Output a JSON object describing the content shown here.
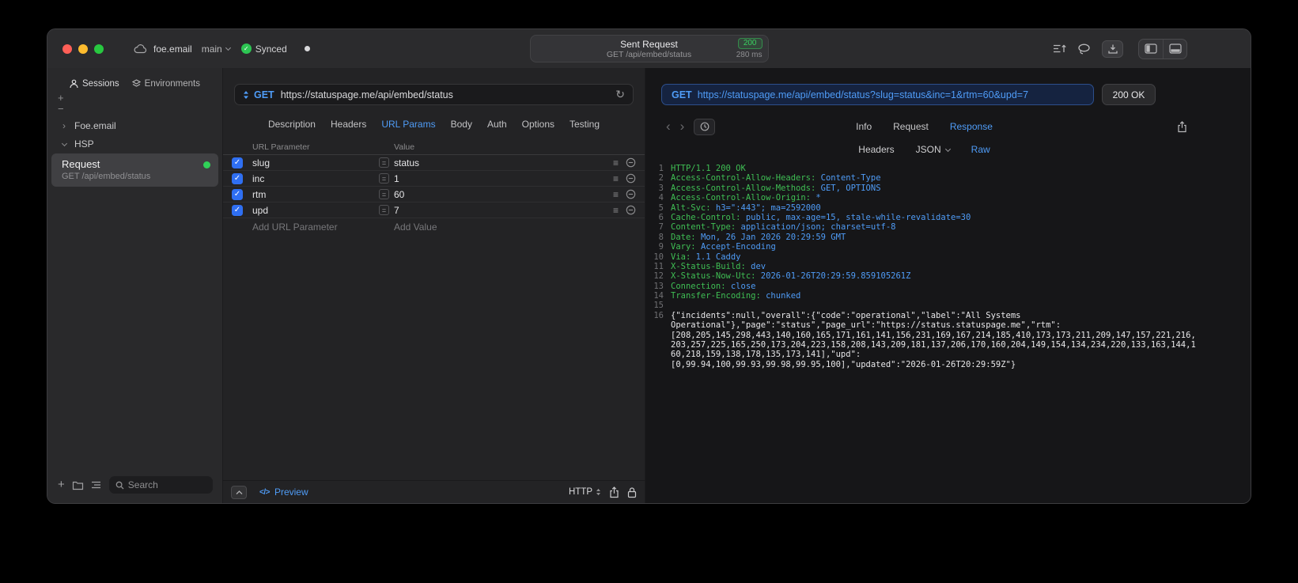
{
  "colors": {
    "accent_blue": "#4f9cf7",
    "header_green": "#3fbf54",
    "value_blue": "#4f9cf7",
    "status_green": "#30d158",
    "checkbox_blue": "#2f6ff2"
  },
  "icons": {
    "refresh": "↻",
    "back": "‹",
    "forward": "›",
    "plus": "+",
    "chevron_right": "›",
    "check": "✓",
    "equals": "=",
    "reorder": "≡"
  },
  "titlebar": {
    "project": "foe.email",
    "branch": "main",
    "sync_label": "Synced",
    "center": {
      "title": "Sent Request",
      "status_code": "200",
      "request_line": "GET /api/embed/status",
      "duration": "280 ms"
    }
  },
  "sidebar": {
    "tabs": [
      {
        "label": "Sessions",
        "icon": "person-icon",
        "active": true
      },
      {
        "label": "Environments",
        "icon": "layers-icon",
        "active": false
      }
    ],
    "add_label": "+",
    "remove_label": "−",
    "tree": [
      {
        "label": "Foe.email",
        "state": "collapsed"
      },
      {
        "label": "HSP",
        "state": "expanded"
      }
    ],
    "request_item": {
      "title": "Request",
      "subtitle": "GET /api/embed/status"
    },
    "search": {
      "placeholder": "Search"
    }
  },
  "request": {
    "method": "GET",
    "url": "https://statuspage.me/api/embed/status",
    "tabs": [
      "Description",
      "Headers",
      "URL Params",
      "Body",
      "Auth",
      "Options",
      "Testing"
    ],
    "active_tab": "URL Params",
    "table": {
      "columns": [
        "URL Parameter",
        "Value"
      ],
      "rows": [
        {
          "name": "slug",
          "value": "status",
          "checked": true
        },
        {
          "name": "inc",
          "value": "1",
          "checked": true
        },
        {
          "name": "rtm",
          "value": "60",
          "checked": true
        },
        {
          "name": "upd",
          "value": "7",
          "checked": true
        }
      ],
      "add_param_placeholder": "Add URL Parameter",
      "add_value_placeholder": "Add Value"
    },
    "footer": {
      "code_glyph": "</>",
      "preview": "Preview",
      "protocol": "HTTP"
    }
  },
  "response": {
    "method": "GET",
    "url": "https://statuspage.me/api/embed/status?slug=status&inc=1&rtm=60&upd=7",
    "status": "200 OK",
    "tabs": [
      "Info",
      "Request",
      "Response"
    ],
    "active_tab": "Response",
    "subtabs": [
      "Headers",
      "JSON",
      "Raw"
    ],
    "active_subtab": "Raw",
    "body": {
      "lines": [
        {
          "num": "1",
          "segs": [
            [
              "HTTP/1.1 200 OK",
              "g"
            ]
          ]
        },
        {
          "num": "2",
          "segs": [
            [
              "Access-Control-Allow-Headers: ",
              "g"
            ],
            [
              "Content-Type",
              "b"
            ]
          ]
        },
        {
          "num": "3",
          "segs": [
            [
              "Access-Control-Allow-Methods: ",
              "g"
            ],
            [
              "GET, OPTIONS",
              "b"
            ]
          ]
        },
        {
          "num": "4",
          "segs": [
            [
              "Access-Control-Allow-Origin: ",
              "g"
            ],
            [
              "*",
              "b"
            ]
          ]
        },
        {
          "num": "5",
          "segs": [
            [
              "Alt-Svc: ",
              "g"
            ],
            [
              "h3=\":443\"; ma=2592000",
              "b"
            ]
          ]
        },
        {
          "num": "6",
          "segs": [
            [
              "Cache-Control: ",
              "g"
            ],
            [
              "public, max-age=15, stale-while-revalidate=30",
              "b"
            ]
          ]
        },
        {
          "num": "7",
          "segs": [
            [
              "Content-Type: ",
              "g"
            ],
            [
              "application/json; charset=utf-8",
              "b"
            ]
          ]
        },
        {
          "num": "8",
          "segs": [
            [
              "Date: ",
              "g"
            ],
            [
              "Mon, 26 Jan 2026 20:29:59 GMT",
              "b"
            ]
          ]
        },
        {
          "num": "9",
          "segs": [
            [
              "Vary: ",
              "g"
            ],
            [
              "Accept-Encoding",
              "b"
            ]
          ]
        },
        {
          "num": "10",
          "segs": [
            [
              "Via: ",
              "g"
            ],
            [
              "1.1 Caddy",
              "b"
            ]
          ]
        },
        {
          "num": "11",
          "segs": [
            [
              "X-Status-Build: ",
              "g"
            ],
            [
              "dev",
              "b"
            ]
          ]
        },
        {
          "num": "12",
          "segs": [
            [
              "X-Status-Now-Utc: ",
              "g"
            ],
            [
              "2026-01-26T20:29:59.859105261Z",
              "b"
            ]
          ]
        },
        {
          "num": "13",
          "segs": [
            [
              "Connection: ",
              "g"
            ],
            [
              "close",
              "b"
            ]
          ]
        },
        {
          "num": "14",
          "segs": [
            [
              "Transfer-Encoding: ",
              "g"
            ],
            [
              "chunked",
              "b"
            ]
          ]
        },
        {
          "num": "15",
          "segs": []
        },
        {
          "num": "16",
          "segs": [
            [
              "{\"incidents\":null,\"overall\":{\"code\":\"operational\",\"label\":\"All Systems",
              "w"
            ]
          ]
        },
        {
          "num": "",
          "segs": [
            [
              "Operational\"},\"page\":\"status\",\"page_url\":\"https://status.statuspage.me\",\"rtm\":",
              "w"
            ]
          ]
        },
        {
          "num": "",
          "segs": [
            [
              "[208,205,145,298,443,140,160,165,171,161,141,156,231,169,167,214,185,410,173,173,211,209,147,157,221,216,",
              "w"
            ]
          ]
        },
        {
          "num": "",
          "segs": [
            [
              "203,257,225,165,250,173,204,223,158,208,143,209,181,137,206,170,160,204,149,154,134,234,220,133,163,144,1",
              "w"
            ]
          ]
        },
        {
          "num": "",
          "segs": [
            [
              "60,218,159,138,178,135,173,141],\"upd\":",
              "w"
            ]
          ]
        },
        {
          "num": "",
          "segs": [
            [
              "[0,99.94,100,99.93,99.98,99.95,100],\"updated\":\"2026-01-26T20:29:59Z\"}",
              "w"
            ]
          ]
        }
      ]
    }
  }
}
